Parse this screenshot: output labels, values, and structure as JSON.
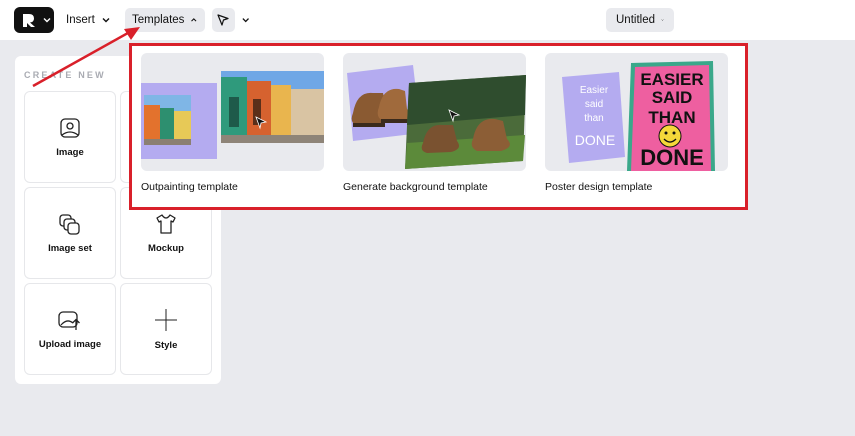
{
  "topbar": {
    "logo_icon": "app-logo-icon",
    "insert_label": "Insert",
    "templates_label": "Templates",
    "tool_icon": "pointer-cursor-icon",
    "document_title": "Untitled"
  },
  "create_panel": {
    "title": "CREATE NEW",
    "items": [
      {
        "label": "Image",
        "icon": "image-icon"
      },
      {
        "label": "",
        "icon": "partially-hidden-tile"
      },
      {
        "label": "Image set",
        "icon": "image-set-icon"
      },
      {
        "label": "Mockup",
        "icon": "tshirt-icon"
      },
      {
        "label": "Upload image",
        "icon": "upload-image-icon"
      },
      {
        "label": "Style",
        "icon": "style-crosshair-icon"
      }
    ]
  },
  "templates_menu": {
    "cards": [
      {
        "label": "Outpainting template"
      },
      {
        "label": "Generate background template"
      },
      {
        "label": "Poster design template"
      }
    ],
    "poster_small_text": [
      "Easier",
      "said",
      "than",
      "DONE"
    ],
    "poster_big_text": [
      "EASIER",
      "SAID",
      "THAN",
      "DONE"
    ]
  },
  "colors": {
    "highlight": "#d9202a",
    "lavender": "#b4abf0",
    "poster_pink": "#ee5fa0",
    "poster_green": "#3aa88a"
  }
}
